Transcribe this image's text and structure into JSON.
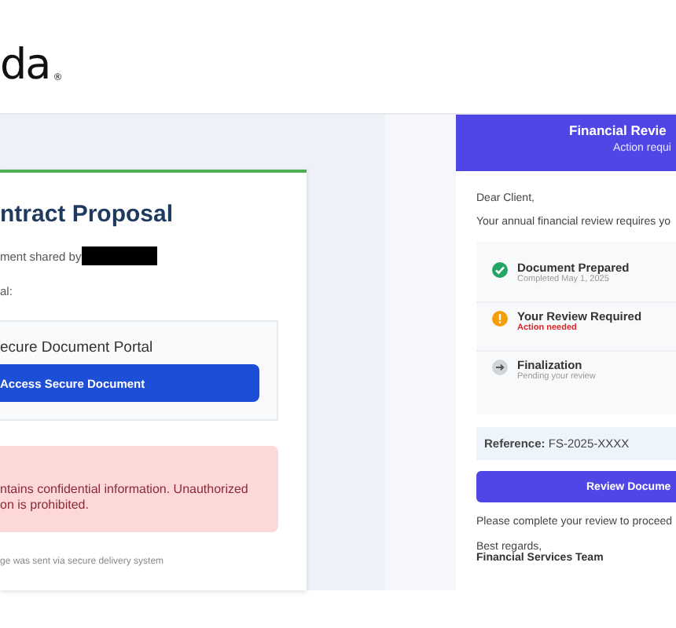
{
  "logo": {
    "text": "da",
    "mark": "®"
  },
  "left_email": {
    "title": "ntract Proposal",
    "shared_by": "ment shared by",
    "redacted": true,
    "label": "al:",
    "portal": {
      "title": "ecure Document Portal",
      "button": "Access Secure Document"
    },
    "warning": [
      "ntains confidential information. Unauthorized",
      "on is prohibited."
    ],
    "footer": "ge was sent via secure delivery system"
  },
  "right_email": {
    "header": {
      "title": "Financial Revie",
      "subtitle": "Action requi"
    },
    "greeting": "Dear Client,",
    "intro": "Your annual financial review requires yo",
    "steps": [
      {
        "kind": "done",
        "title": "Document Prepared",
        "note": "Completed May 1, 2025"
      },
      {
        "kind": "warning",
        "title": "Your Review Required",
        "note": "Action needed"
      },
      {
        "kind": "pending",
        "title": "Finalization",
        "note": "Pending your review"
      }
    ],
    "reference": "**Reference:** FS-2025-XXXX",
    "button": "Review Docume",
    "closing": "Please complete your review to proceed",
    "signoff": "Best regards,",
    "team": "Financial Services Team"
  }
}
